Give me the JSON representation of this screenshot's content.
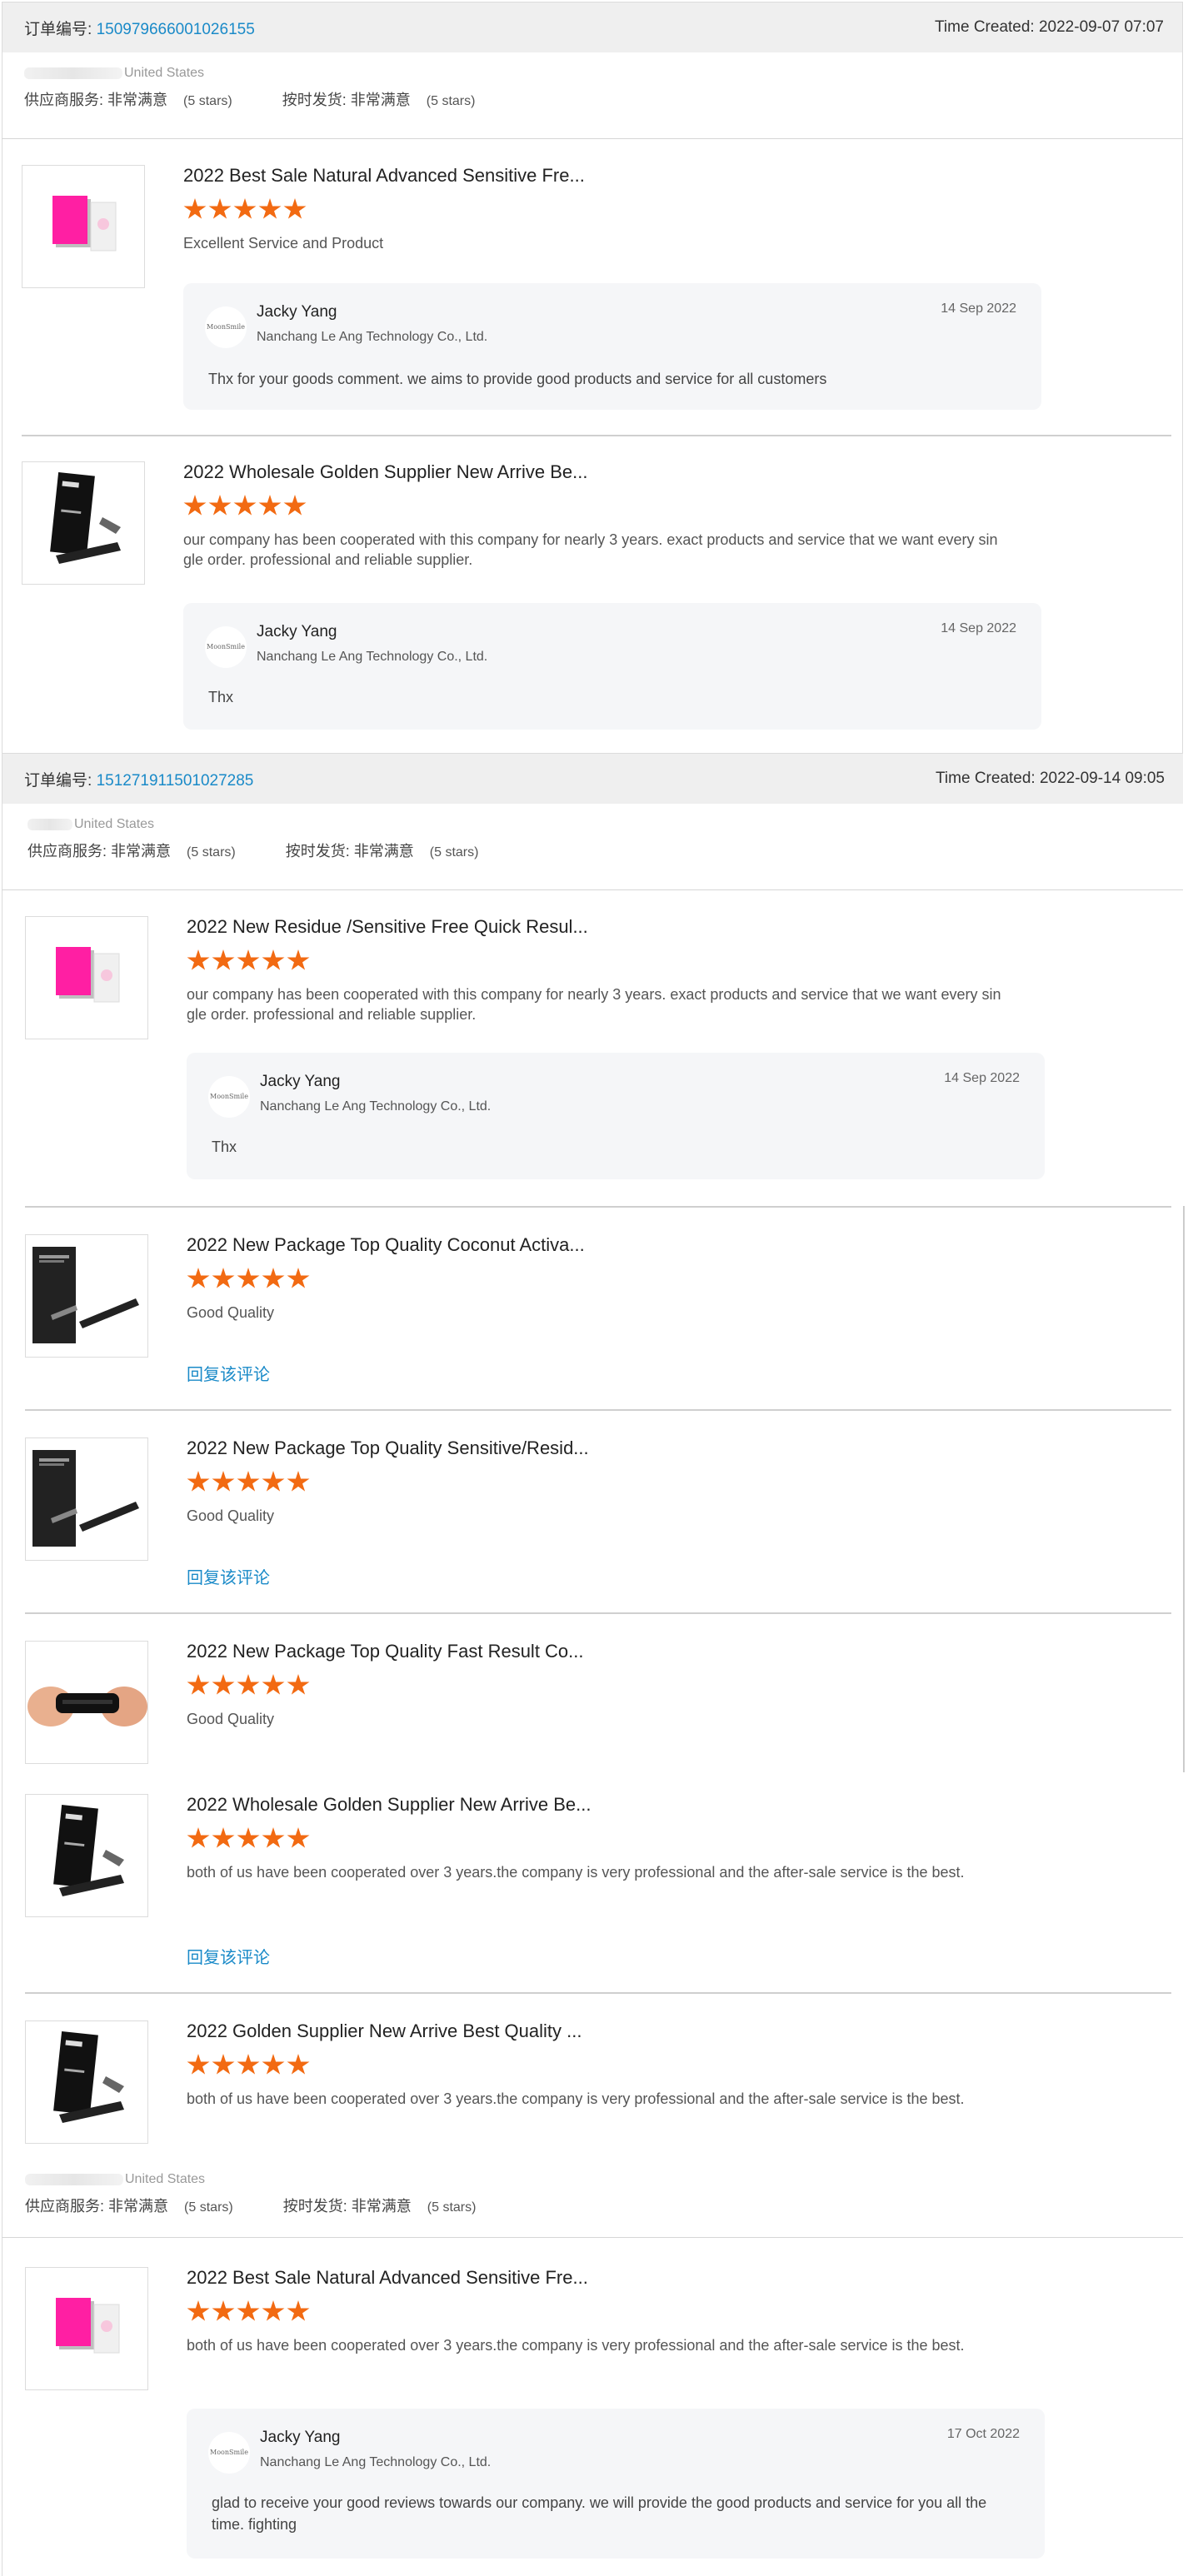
{
  "order1": {
    "label": "订单编号:",
    "number": "150979666001026155",
    "time": "Time Created: 2022-09-07 07:07",
    "country": "United States",
    "service_label": "供应商服务:",
    "service_value": "非常满意",
    "service_stars": "(5 stars)",
    "delivery_label": "按时发货:",
    "delivery_value": "非常满意",
    "delivery_stars": "(5 stars)",
    "items": [
      {
        "title": "2022 Best Sale Natural Advanced Sensitive Fre...",
        "rating": 5,
        "comment": "Excellent Service and Product",
        "reply": {
          "avatar": "MoonSmile",
          "name": "Jacky Yang",
          "company": "Nanchang Le Ang Technology Co., Ltd.",
          "date": "14 Sep 2022",
          "text": "Thx for your goods comment. we aims to provide good products and service for all customers"
        }
      },
      {
        "title": "2022 Wholesale Golden Supplier New Arrive Be...",
        "rating": 5,
        "comment": "our company has been cooperated with this company for nearly 3 years. exact products and service that we want every single order. professional and reliable supplier.",
        "reply": {
          "avatar": "MoonSmile",
          "name": "Jacky Yang",
          "company": "Nanchang Le Ang Technology Co., Ltd.",
          "date": "14 Sep 2022",
          "text": "Thx"
        }
      }
    ]
  },
  "order2": {
    "label": "订单编号:",
    "number": "151271911501027285",
    "time": "Time Created: 2022-09-14 09:05",
    "country": "United States",
    "service_label": "供应商服务:",
    "service_value": "非常满意",
    "service_stars": "(5 stars)",
    "delivery_label": "按时发货:",
    "delivery_value": "非常满意",
    "delivery_stars": "(5 stars)",
    "items": [
      {
        "title": "2022 New Residue /Sensitive Free Quick Resul...",
        "rating": 5,
        "comment": "our company has been cooperated with this company for nearly 3 years. exact products and service that we want every single order. professional and reliable supplier.",
        "reply": {
          "avatar": "MoonSmile",
          "name": "Jacky Yang",
          "company": "Nanchang Le Ang Technology Co., Ltd.",
          "date": "14 Sep 2022",
          "text": "Thx"
        }
      },
      {
        "title": "2022 New Package Top Quality Coconut Activa...",
        "rating": 5,
        "comment": "Good Quality",
        "reply_link": "回复该评论"
      },
      {
        "title": "2022 New Package Top Quality Sensitive/Resid...",
        "rating": 5,
        "comment": "Good Quality",
        "reply_link": "回复该评论"
      },
      {
        "title": "2022 New Package Top Quality Fast Result Co...",
        "rating": 5,
        "comment": "Good Quality"
      },
      {
        "title": "2022 Wholesale Golden Supplier New Arrive Be...",
        "rating": 5,
        "comment": "both of us have been cooperated over 3 years.the company is very professional and the after-sale service is the best.",
        "reply_link": "回复该评论"
      },
      {
        "title": "2022 Golden Supplier New Arrive Best Quality ...",
        "rating": 5,
        "comment": "both of us have been cooperated over 3 years.the company is very professional and the after-sale service is the best."
      }
    ]
  },
  "order3": {
    "country": "United States",
    "service_label": "供应商服务:",
    "service_value": "非常满意",
    "service_stars": "(5 stars)",
    "delivery_label": "按时发货:",
    "delivery_value": "非常满意",
    "delivery_stars": "(5 stars)",
    "items": [
      {
        "title": "2022 Best Sale Natural Advanced Sensitive Fre...",
        "rating": 5,
        "comment": "both of us have been cooperated over 3 years.the company is very professional and the after-sale service is the best.",
        "reply": {
          "avatar": "MoonSmile",
          "name": "Jacky Yang",
          "company": "Nanchang Le Ang Technology Co., Ltd.",
          "date": "17 Oct 2022",
          "text": "glad to receive your good reviews towards our company. we will provide the good products and service for you all the time. fighting"
        }
      }
    ]
  },
  "colors": {
    "star": "#f26a12",
    "link": "#1a8ac8",
    "header_bg": "#efefef",
    "reply_bg": "#f5f6f8"
  }
}
